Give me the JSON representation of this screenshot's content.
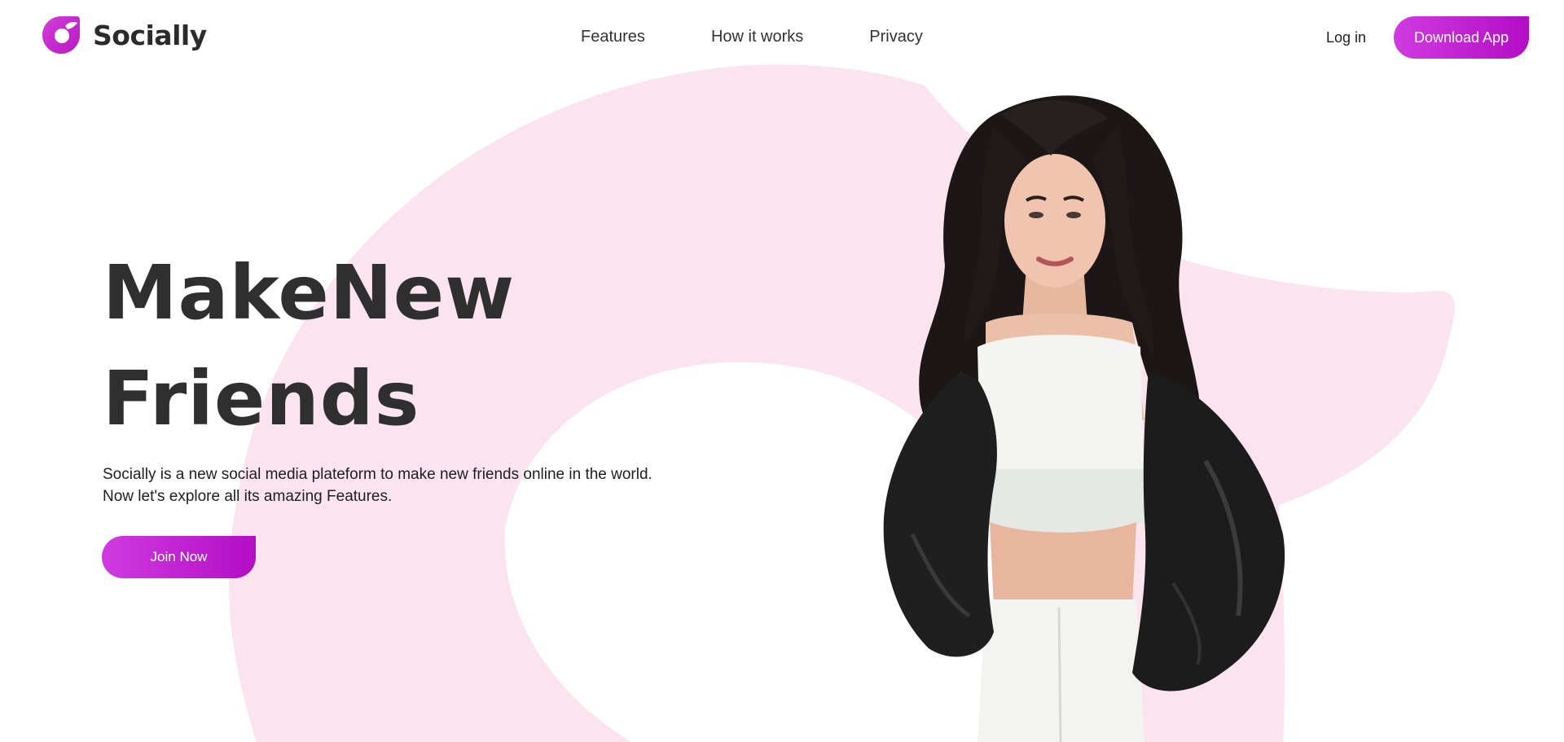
{
  "brand": {
    "name": "Socially",
    "accent_color": "#cc2ed9",
    "accent_gradient": [
      "#cf3be0",
      "#b30ec5"
    ],
    "background_shape_color": "#fbe4ee",
    "logo_icon": "logo-mark-icon"
  },
  "nav": {
    "items": [
      {
        "label": "Features"
      },
      {
        "label": "How it works"
      },
      {
        "label": "Privacy"
      }
    ],
    "login_label": "Log in",
    "download_label": "Download App"
  },
  "hero": {
    "title_line1": "MakeNew",
    "title_line2": "Friends",
    "description_line1": "Socially is a new social media plateform to make new friends online in the world.",
    "description_line2": "Now let's explore all its amazing Features.",
    "cta_label": "Join Now",
    "image": "woman-portrait-image"
  }
}
